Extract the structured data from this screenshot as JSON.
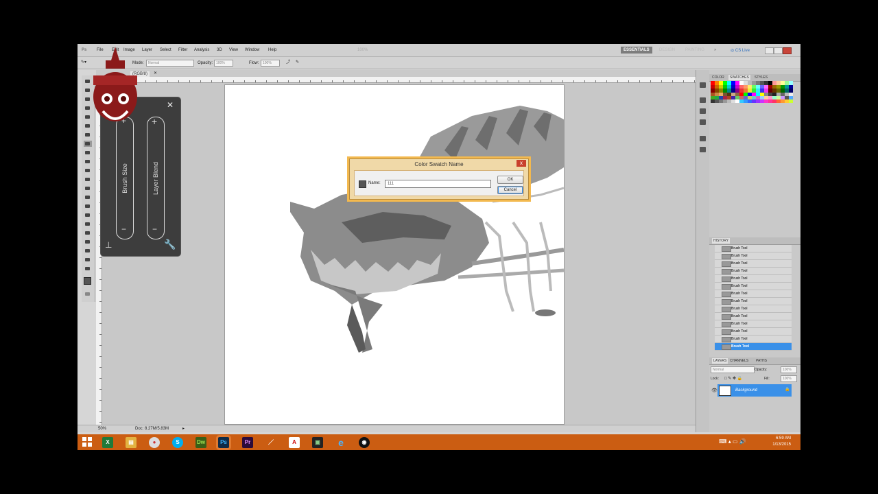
{
  "menubar": {
    "logo": "Ps",
    "items": [
      "File",
      "Edit",
      "Image",
      "Layer",
      "Select",
      "Filter",
      "Analysis",
      "3D",
      "View",
      "Window",
      "Help"
    ],
    "zoom": "100%",
    "workspaces": [
      "ESSENTIALS",
      "DESIGN",
      "PAINTING"
    ],
    "more": "»",
    "cs_live": "CS Live"
  },
  "options": {
    "mode_label": "Mode:",
    "mode_value": "Normal",
    "opacity_label": "Opacity:",
    "opacity_value": "100%",
    "flow_label": "Flow:",
    "flow_value": "100%"
  },
  "document": {
    "tab_label": "(RGB/8)",
    "zoom": "50%",
    "doc_info": "Doc: 8.27M/5.83M"
  },
  "brush_panel": {
    "brush_size_label": "Brush Size",
    "layer_blend_label": "Layer Blend",
    "plus": "+",
    "minus": "−",
    "close": "✕"
  },
  "dialog": {
    "title": "Color Swatch Name",
    "name_label": "Name:",
    "name_value": "111",
    "ok": "OK",
    "cancel": "Cancel",
    "close": "x"
  },
  "panels": {
    "swatch_tabs": [
      "COLOR",
      "SWATCHES",
      "STYLES"
    ],
    "history_tab": "HISTORY",
    "history_items": [
      "Brush Tool",
      "Brush Tool",
      "Brush Tool",
      "Brush Tool",
      "Brush Tool",
      "Brush Tool",
      "Brush Tool",
      "Brush Tool",
      "Brush Tool",
      "Brush Tool",
      "Brush Tool",
      "Brush Tool",
      "Brush Tool",
      "Brush Tool"
    ],
    "layers_tabs": [
      "LAYERS",
      "CHANNELS",
      "PATHS"
    ],
    "blend_mode": "Normal",
    "opacity_label": "Opacity:",
    "opacity_value": "100%",
    "fill_label": "Fill:",
    "fill_value": "100%",
    "lock_label": "Lock:",
    "layer_name": "Background"
  },
  "taskbar": {
    "time": "6:59 AM",
    "date": "1/13/2015",
    "apps": [
      "Excel",
      "Explorer",
      "Chrome",
      "Skype",
      "Dreamweaver",
      "Photoshop",
      "Premiere",
      "Pen",
      "Acrobat",
      "Media",
      "Internet Explorer",
      "OBS"
    ]
  },
  "colors": {
    "taskbar": "#cb5d12",
    "history_selected": "#3a90e8",
    "dialog_frame": "#f3b94f",
    "layer_selected": "#3a90e8"
  }
}
